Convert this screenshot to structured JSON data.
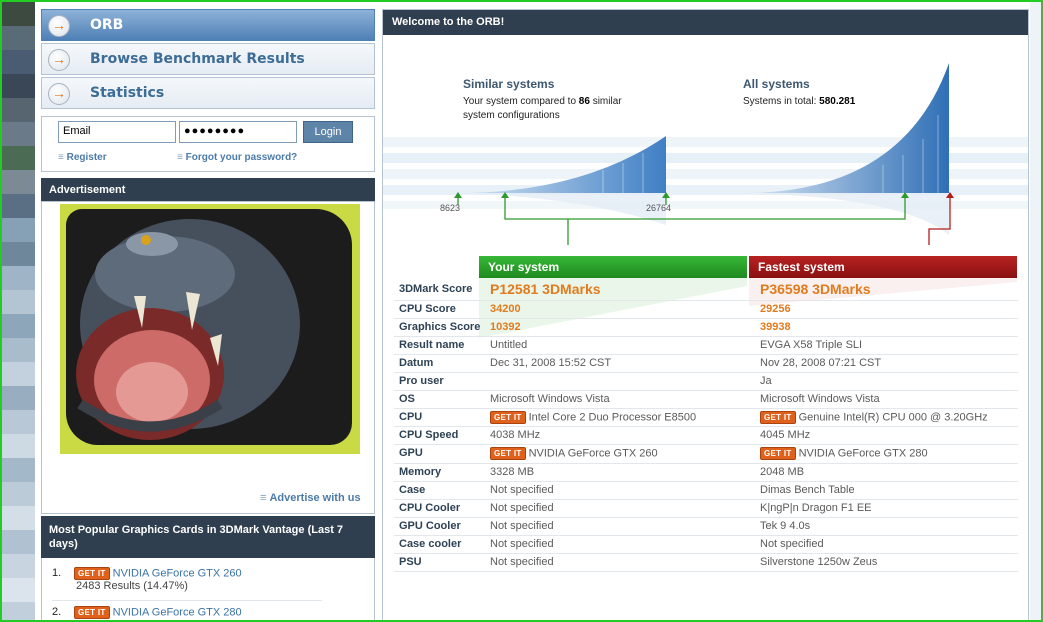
{
  "colors": {
    "accent_blue": "#4f80b6",
    "your_green": "#2ea62e",
    "fastest_red": "#a01818",
    "score_orange": "#e27b1e",
    "panel_dark": "#2f3f50"
  },
  "nav": [
    {
      "label": "ORB",
      "icon": "arrow-right-icon",
      "active": true
    },
    {
      "label": "Browse Benchmark Results",
      "icon": "arrow-right-icon"
    },
    {
      "label": "Statistics",
      "icon": "arrow-right-icon"
    }
  ],
  "login": {
    "email_value": "Email",
    "password_value": "●●●●●●●●",
    "button": "Login",
    "register": "Register",
    "forgot": "Forgot your password?"
  },
  "advertisement": {
    "title": "Advertisement",
    "link": "Advertise with us"
  },
  "popular": {
    "title": "Most Popular Graphics Cards in 3DMark Vantage (Last 7 days)",
    "get_it": "GET IT",
    "items": [
      {
        "rank": "1.",
        "name": "NVIDIA GeForce GTX 260",
        "results": "2483 Results (14.47%)"
      },
      {
        "rank": "2.",
        "name": "NVIDIA GeForce GTX 280",
        "results": ""
      }
    ]
  },
  "main": {
    "title": "Welcome to the ORB!",
    "similar": {
      "title": "Similar systems",
      "text_before": "Your system compared to ",
      "count": "86",
      "text_after": " similar system configurations",
      "min": "8623",
      "max": "26764"
    },
    "all": {
      "title": "All systems",
      "text_before": "Systems in total: ",
      "count": "580.281"
    },
    "your_system": "Your system",
    "fastest_system": "Fastest system",
    "get_it": "GET IT",
    "rows": [
      {
        "label": "3DMark Score",
        "your": "P12581 3DMarks",
        "fastest": "P36598 3DMarks",
        "style": "big"
      },
      {
        "label": "CPU Score",
        "your": "34200",
        "fastest": "29256",
        "style": "score"
      },
      {
        "label": "Graphics Score",
        "your": "10392",
        "fastest": "39938",
        "style": "score"
      },
      {
        "label": "Result name",
        "your": "Untitled",
        "fastest": "EVGA X58 Triple SLI"
      },
      {
        "label": "Datum",
        "your": "Dec 31, 2008 15:52 CST",
        "fastest": "Nov 28, 2008 07:21 CST"
      },
      {
        "label": "Pro user",
        "your": "",
        "fastest": "Ja"
      },
      {
        "label": "OS",
        "your": "Microsoft Windows Vista",
        "fastest": "Microsoft Windows Vista"
      },
      {
        "label": "CPU",
        "your": "Intel Core 2 Duo Processor E8500",
        "fastest": "Genuine Intel(R) CPU 000 @ 3.20GHz",
        "getit": true
      },
      {
        "label": "CPU Speed",
        "your": "4038 MHz",
        "fastest": "4045 MHz"
      },
      {
        "label": "GPU",
        "your": "NVIDIA GeForce GTX 260",
        "fastest": "NVIDIA GeForce GTX 280",
        "getit": true
      },
      {
        "label": "Memory",
        "your": "3328 MB",
        "fastest": "2048 MB"
      },
      {
        "label": "Case",
        "your": "Not specified",
        "fastest": "Dimas Bench Table"
      },
      {
        "label": "CPU Cooler",
        "your": "Not specified",
        "fastest": "K|ngP|n Dragon F1 EE"
      },
      {
        "label": "GPU Cooler",
        "your": "Not specified",
        "fastest": "Tek 9 4.0s"
      },
      {
        "label": "Case cooler",
        "your": "Not specified",
        "fastest": "Not specified"
      },
      {
        "label": "PSU",
        "your": "Not specified",
        "fastest": "Silverstone 1250w Zeus"
      }
    ]
  }
}
